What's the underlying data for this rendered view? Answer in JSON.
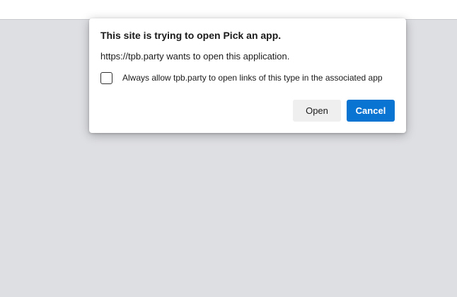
{
  "dialog": {
    "title": "This site is trying to open Pick an app.",
    "message": "https://tpb.party wants to open this application.",
    "checkbox_label": "Always allow tpb.party to open links of this type in the associated app",
    "checkbox_checked": false,
    "open_label": "Open",
    "cancel_label": "Cancel"
  },
  "colors": {
    "background": "#dedfe3",
    "primary_button": "#0a74d3",
    "secondary_button": "#efefef"
  }
}
